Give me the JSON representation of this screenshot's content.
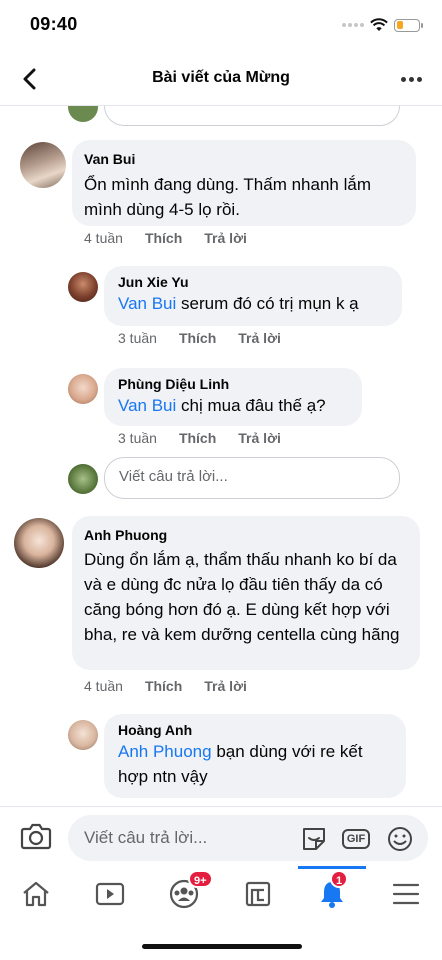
{
  "status_bar": {
    "time": "09:40"
  },
  "nav": {
    "title": "Bài viết của Mừng",
    "back_icon": "back-arrow-icon",
    "more_icon": "more-dots-icon"
  },
  "comments": [
    {
      "author": "Van Bui",
      "text": "Ổn mình đang dùng. Thấm nhanh lắm mình dùng 4-5 lọ rồi.",
      "time": "4 tuần",
      "like_label": "Thích",
      "reply_label": "Trả lời",
      "replies": [
        {
          "author": "Jun Xie Yu",
          "mention": "Van Bui",
          "text": " serum đó có trị mụn k ạ",
          "time": "3 tuần",
          "like_label": "Thích",
          "reply_label": "Trả lời"
        },
        {
          "author": "Phùng Diệu Linh",
          "mention": "Van Bui",
          "text": " chị mua đâu thế ạ?",
          "time": "3 tuần",
          "like_label": "Thích",
          "reply_label": "Trả lời"
        }
      ],
      "reply_placeholder": "Viết câu trả lời..."
    },
    {
      "author": "Anh Phuong",
      "text": "Dùng ổn lắm ạ, thẩm thấu nhanh ko bí da và e dùng đc nửa lọ đầu tiên thấy da có căng bóng hơn đó ạ. E dùng kết hợp với bha, re và kem dưỡng centella cùng hãng",
      "time": "4 tuần",
      "like_label": "Thích",
      "reply_label": "Trả lời",
      "replies": [
        {
          "author": "Hoàng Anh",
          "mention": "Anh Phuong",
          "text": " bạn dùng với re kết hợp ntn vậy"
        }
      ]
    }
  ],
  "composer": {
    "placeholder": "Viết câu trả lời...",
    "camera_icon": "camera-icon",
    "sticker_icon": "sticker-icon",
    "gif_label": "GIF",
    "emoji_icon": "emoji-icon"
  },
  "tabbar": {
    "items": [
      {
        "name": "home",
        "icon": "home-icon"
      },
      {
        "name": "watch",
        "icon": "video-icon"
      },
      {
        "name": "groups",
        "icon": "groups-icon",
        "badge": "9+"
      },
      {
        "name": "gaming",
        "icon": "gaming-icon"
      },
      {
        "name": "notifications",
        "icon": "bell-icon",
        "badge": "1",
        "active": true
      },
      {
        "name": "menu",
        "icon": "menu-icon"
      }
    ]
  },
  "colors": {
    "accent": "#1877f2",
    "bubble": "#f0f2f5",
    "badge": "#e41e3f"
  }
}
